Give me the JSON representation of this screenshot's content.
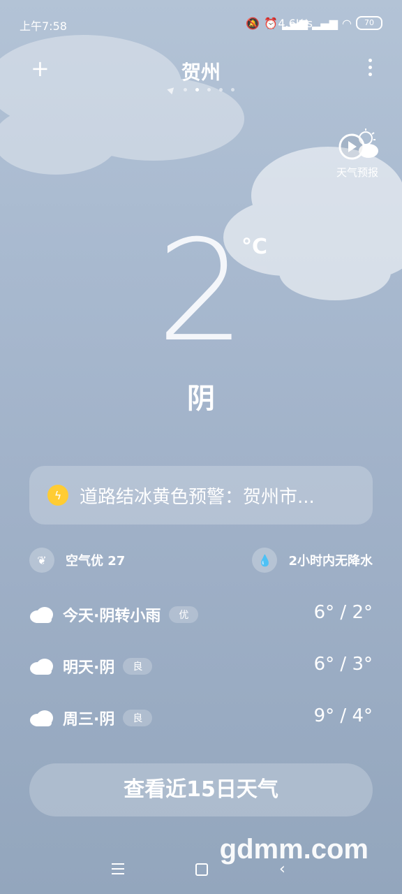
{
  "status_bar": {
    "time": "上午7:58",
    "speed": "4.6K/s",
    "battery": "70"
  },
  "header": {
    "city": "贺州",
    "pages_count": 5,
    "active_page": 2
  },
  "forecast_button": {
    "label": "天气预报"
  },
  "current": {
    "temperature": "2",
    "unit": "°C",
    "condition": "阴"
  },
  "alert": {
    "text": "道路结冰黄色预警：贺州市..."
  },
  "info": {
    "air": "空气优 27",
    "rain": "2小时内无降水"
  },
  "days": [
    {
      "label": "今天·阴转小雨",
      "aqi": "优",
      "range": "6° / 2°"
    },
    {
      "label": "明天·阴",
      "aqi": "良",
      "range": "6° / 3°"
    },
    {
      "label": "周三·阴",
      "aqi": "良",
      "range": "9° / 4°"
    }
  ],
  "button_15": {
    "label": "查看近15日天气"
  },
  "watermark": "gdmm.com",
  "colors": {
    "alert_icon": "#ffcc33",
    "background_top": "#b3c3d6",
    "background_bottom": "#93a6bd"
  }
}
